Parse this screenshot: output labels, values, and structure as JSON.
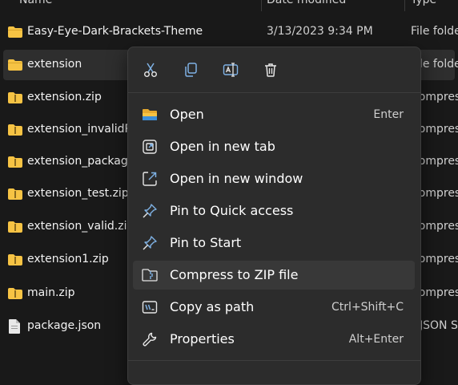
{
  "header": {
    "col_name": "Name",
    "col_date": "Date modified",
    "col_type": "Type"
  },
  "files": [
    {
      "name": "Easy-Eye-Dark-Brackets-Theme",
      "date": "3/13/2023 9:34 PM",
      "type": "File folder",
      "icon": "folder-icon"
    },
    {
      "name": "extension",
      "date": "",
      "type": "File folder",
      "icon": "folder-icon"
    },
    {
      "name": "extension.zip",
      "date": "",
      "type": "Compressed",
      "icon": "zip-folder-icon"
    },
    {
      "name": "extension_invalidPa",
      "date": "",
      "type": "Compressed",
      "icon": "zip-folder-icon"
    },
    {
      "name": "extension_packagF",
      "date": "",
      "type": "Compressed",
      "icon": "zip-folder-icon"
    },
    {
      "name": "extension_test.zip",
      "date": "",
      "type": "Compressed",
      "icon": "zip-folder-icon"
    },
    {
      "name": "extension_valid.zip",
      "date": "",
      "type": "Compressed",
      "icon": "zip-folder-icon"
    },
    {
      "name": "extension1.zip",
      "date": "",
      "type": "Compressed",
      "icon": "zip-folder-icon"
    },
    {
      "name": "main.zip",
      "date": "",
      "type": "Compressed",
      "icon": "zip-folder-icon"
    },
    {
      "name": "package.json",
      "date": "",
      "type": "JSON Sou",
      "icon": "file-icon"
    }
  ],
  "context_menu": {
    "toolbar": [
      {
        "name": "cut",
        "icon": "scissors-icon"
      },
      {
        "name": "copy",
        "icon": "copy-icon"
      },
      {
        "name": "rename",
        "icon": "rename-icon"
      },
      {
        "name": "delete",
        "icon": "trash-icon"
      }
    ],
    "items": [
      {
        "label": "Open",
        "shortcut": "Enter",
        "icon": "folder-open-icon"
      },
      {
        "label": "Open in new tab",
        "shortcut": "",
        "icon": "new-tab-icon"
      },
      {
        "label": "Open in new window",
        "shortcut": "",
        "icon": "new-window-icon"
      },
      {
        "label": "Pin to Quick access",
        "shortcut": "",
        "icon": "pin-icon"
      },
      {
        "label": "Pin to Start",
        "shortcut": "",
        "icon": "pin-icon"
      },
      {
        "label": "Compress to ZIP file",
        "shortcut": "",
        "icon": "zip-icon"
      },
      {
        "label": "Copy as path",
        "shortcut": "Ctrl+Shift+C",
        "icon": "copy-path-icon"
      },
      {
        "label": "Properties",
        "shortcut": "Alt+Enter",
        "icon": "wrench-icon"
      }
    ]
  },
  "colors": {
    "background": "#191919",
    "menu": "#2c2c2c",
    "folder": "#f6c344",
    "accent": "#5aa9e6"
  }
}
